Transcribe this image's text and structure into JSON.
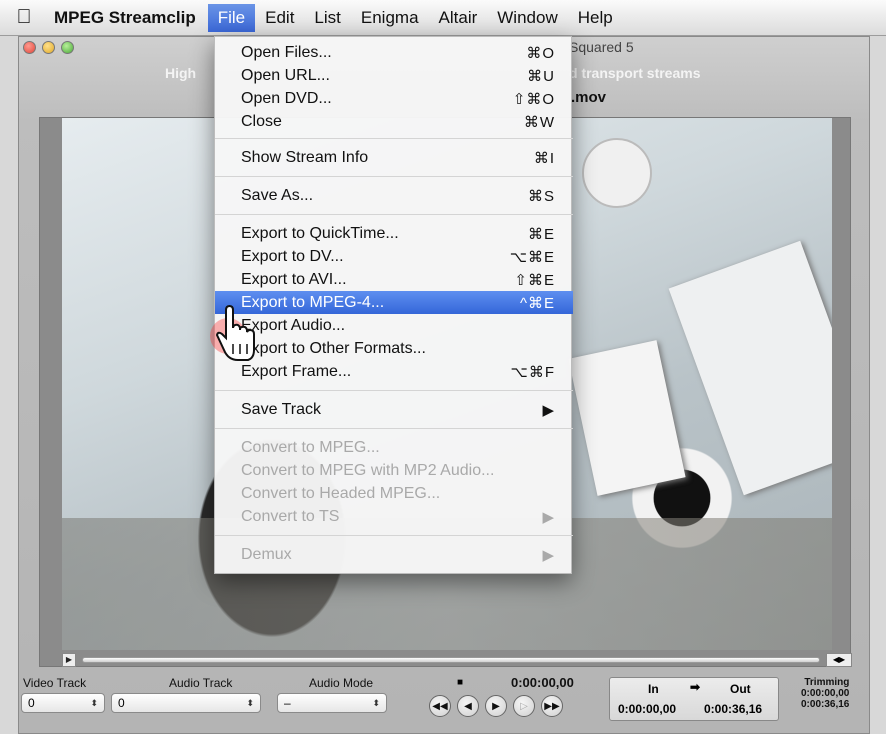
{
  "menubar": {
    "app_name": "MPEG Streamclip",
    "items": [
      "File",
      "Edit",
      "List",
      "Enigma",
      "Altair",
      "Window",
      "Help"
    ]
  },
  "window": {
    "title_partial": "Squared 5",
    "subtitle_left": "High",
    "subtitle_right": "d transport streams",
    "filename_partial": ".mov"
  },
  "file_menu": {
    "items": [
      {
        "label": "Open Files...",
        "shortcut": "⌘O"
      },
      {
        "label": "Open URL...",
        "shortcut": "⌘U"
      },
      {
        "label": "Open DVD...",
        "shortcut": "⇧⌘O"
      },
      {
        "label": "Close",
        "shortcut": "⌘W"
      },
      {
        "label": "Show Stream Info",
        "shortcut": "⌘I"
      },
      {
        "label": "Save As...",
        "shortcut": "⌘S"
      },
      {
        "label": "Export to QuickTime...",
        "shortcut": "⌘E"
      },
      {
        "label": "Export to DV...",
        "shortcut": "⌥⌘E"
      },
      {
        "label": "Export to AVI...",
        "shortcut": "⇧⌘E"
      },
      {
        "label": "Export to MPEG-4...",
        "shortcut": "^⌘E"
      },
      {
        "label": "Export Audio...",
        "shortcut": ""
      },
      {
        "label": "Export to Other Formats...",
        "shortcut": ""
      },
      {
        "label": "Export Frame...",
        "shortcut": "⌥⌘F"
      },
      {
        "label": "Save Track",
        "shortcut": "▶"
      },
      {
        "label": "Convert to MPEG...",
        "shortcut": ""
      },
      {
        "label": "Convert to MPEG with MP2 Audio...",
        "shortcut": ""
      },
      {
        "label": "Convert to Headed MPEG...",
        "shortcut": ""
      },
      {
        "label": "Convert to TS",
        "shortcut": "▶"
      },
      {
        "label": "Demux",
        "shortcut": "▶"
      }
    ]
  },
  "controls": {
    "video_track_label": "Video Track",
    "video_track_value": "0",
    "audio_track_label": "Audio Track",
    "audio_track_value": "0",
    "audio_mode_label": "Audio Mode",
    "audio_mode_value": "–",
    "current_time": "0:00:00,00",
    "in_label": "In",
    "out_label": "Out",
    "in_value": "0:00:00,00",
    "out_value": "0:00:36,16",
    "trimming_label": "Trimming",
    "trimming_start": "0:00:00,00",
    "trimming_end": "0:00:36,16"
  }
}
